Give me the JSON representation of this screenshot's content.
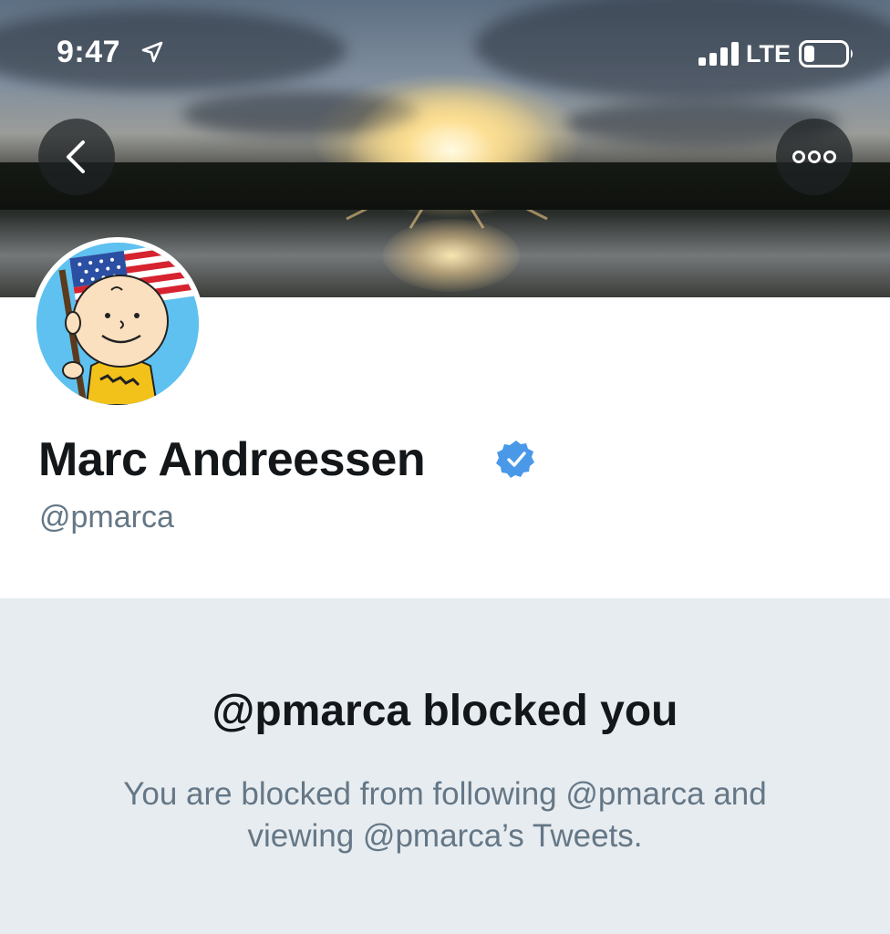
{
  "status_bar": {
    "time": "9:47",
    "network": "LTE",
    "location_icon": "location-arrow-icon",
    "signal_icon": "cellular-signal-icon",
    "battery_icon": "battery-low-icon"
  },
  "header": {
    "back_icon": "chevron-left-icon",
    "more_icon": "more-dots-icon"
  },
  "profile": {
    "display_name": "Marc Andreessen",
    "handle": "@pmarca",
    "verified_icon": "verified-badge-icon",
    "verified_color": "#4a99e9"
  },
  "blocked": {
    "title": "@pmarca blocked you",
    "description": "You are blocked from following @pmarca and viewing @pmarca’s Tweets."
  },
  "colors": {
    "panel_background": "#e6ecf0",
    "primary_text": "#14171a",
    "secondary_text": "#657786"
  }
}
